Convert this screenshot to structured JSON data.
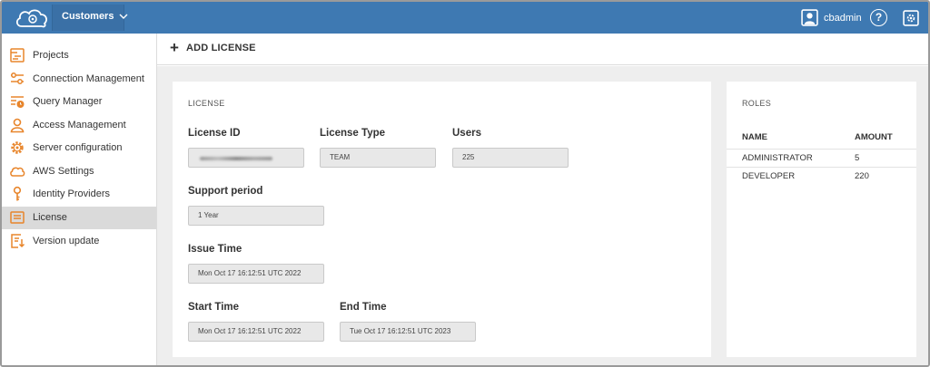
{
  "topbar": {
    "project_selector": "Customers",
    "username": "cbadmin",
    "help_symbol": "?"
  },
  "sidebar": {
    "items": [
      {
        "label": "Projects",
        "icon": "projects-icon"
      },
      {
        "label": "Connection Management",
        "icon": "connection-icon"
      },
      {
        "label": "Query Manager",
        "icon": "query-manager-icon"
      },
      {
        "label": "Access Management",
        "icon": "user-icon"
      },
      {
        "label": "Server configuration",
        "icon": "gear-icon"
      },
      {
        "label": "AWS Settings",
        "icon": "cloud-icon"
      },
      {
        "label": "Identity Providers",
        "icon": "key-icon"
      },
      {
        "label": "License",
        "icon": "license-icon",
        "active": true
      },
      {
        "label": "Version update",
        "icon": "version-update-icon"
      }
    ],
    "icon_color": "#e8852b"
  },
  "header": {
    "add_license_label": "ADD LICENSE",
    "plus_symbol": "+"
  },
  "license": {
    "section_title": "LICENSE",
    "license_id_label": "License ID",
    "license_type_label": "License Type",
    "license_type_value": "TEAM",
    "users_label": "Users",
    "users_value": "225",
    "support_period_label": "Support period",
    "support_period_value": "1 Year",
    "issue_time_label": "Issue Time",
    "issue_time_value": "Mon Oct 17 16:12:51 UTC 2022",
    "start_time_label": "Start Time",
    "start_time_value": "Mon Oct 17 16:12:51 UTC 2022",
    "end_time_label": "End Time",
    "end_time_value": "Tue Oct 17 16:12:51 UTC 2023"
  },
  "roles": {
    "section_title": "ROLES",
    "columns": [
      "NAME",
      "AMOUNT"
    ],
    "rows": [
      {
        "name": "ADMINISTRATOR",
        "amount": "5"
      },
      {
        "name": "DEVELOPER",
        "amount": "220"
      }
    ]
  },
  "colors": {
    "topbar": "#3e79b2",
    "accent_orange": "#e8852b",
    "active_nav": "#dadada",
    "content_bg": "#eeeeee"
  }
}
